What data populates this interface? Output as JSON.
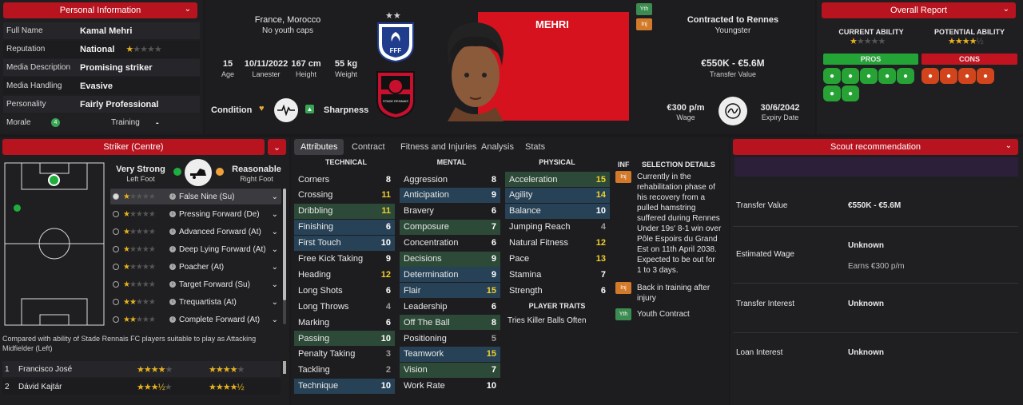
{
  "personal": {
    "title": "Personal Information",
    "rows": [
      {
        "k": "Full Name",
        "v": "Kamal Mehri"
      },
      {
        "k": "Reputation",
        "v": "National"
      },
      {
        "k": "Media Description",
        "v": "Promising striker"
      },
      {
        "k": "Media Handling",
        "v": "Evasive"
      },
      {
        "k": "Personality",
        "v": "Fairly Professional"
      }
    ],
    "morale_label": "Morale",
    "morale_value": "4",
    "training_label": "Training",
    "training_value": "-"
  },
  "header": {
    "nationality": "France, Morocco",
    "caps": "No youth caps",
    "stats": [
      {
        "v": "15",
        "k": "Age"
      },
      {
        "v": "10/11/2022",
        "k": "Lanester"
      },
      {
        "v": "167 cm",
        "k": "Height"
      },
      {
        "v": "55 kg",
        "k": "Weight"
      }
    ],
    "condition": "Condition",
    "sharpness": "Sharpness",
    "player_name": "MEHRI",
    "badge_yth": "Yth",
    "badge_inj": "Inj",
    "club_short": "STADE RENNAIS",
    "fed": "FFF"
  },
  "contract": {
    "status": "Contracted to Rennes",
    "sub": "Youngster",
    "value": "€550K - €5.6M",
    "value_label": "Transfer Value",
    "wage": "€300 p/m",
    "wage_label": "Wage",
    "expiry": "30/6/2042",
    "expiry_label": "Expiry Date"
  },
  "report": {
    "title": "Overall Report",
    "ca_label": "CURRENT ABILITY",
    "pa_label": "POTENTIAL ABILITY",
    "pros": "PROS",
    "cons": "CONS"
  },
  "position": {
    "title": "Striker (Centre)",
    "strong": "Very Strong",
    "foot_l": "Left Foot",
    "reasonable": "Reasonable",
    "foot_r": "Right Foot",
    "roles": [
      {
        "name": "False Nine (Su)",
        "stars": 1
      },
      {
        "name": "Pressing Forward (De)",
        "stars": 1
      },
      {
        "name": "Advanced Forward (At)",
        "stars": 1
      },
      {
        "name": "Deep Lying Forward (At)",
        "stars": 1
      },
      {
        "name": "Poacher (At)",
        "stars": 1
      },
      {
        "name": "Target Forward (Su)",
        "stars": 1
      },
      {
        "name": "Trequartista (At)",
        "stars": 2
      },
      {
        "name": "Complete Forward (At)",
        "stars": 2
      }
    ],
    "compare": "Compared with ability of Stade Rennais FC players suitable to play as Attacking Midfielder (Left)",
    "comp_players": [
      {
        "n": "1",
        "name": "Francisco José"
      },
      {
        "n": "2",
        "name": "Dávid Kajtár"
      }
    ]
  },
  "tabs": [
    "Attributes",
    "Contract",
    "Fitness and Injuries",
    "Analysis",
    "Stats"
  ],
  "attr": {
    "technical_h": "TECHNICAL",
    "mental_h": "MENTAL",
    "physical_h": "PHYSICAL",
    "technical": [
      [
        "Corners",
        "8"
      ],
      [
        "Crossing",
        "11"
      ],
      [
        "Dribbling",
        "11"
      ],
      [
        "Finishing",
        "6"
      ],
      [
        "First Touch",
        "10"
      ],
      [
        "Free Kick Taking",
        "9"
      ],
      [
        "Heading",
        "12"
      ],
      [
        "Long Shots",
        "6"
      ],
      [
        "Long Throws",
        "4"
      ],
      [
        "Marking",
        "6"
      ],
      [
        "Passing",
        "10"
      ],
      [
        "Penalty Taking",
        "3"
      ],
      [
        "Tackling",
        "2"
      ],
      [
        "Technique",
        "10"
      ]
    ],
    "mental": [
      [
        "Aggression",
        "8"
      ],
      [
        "Anticipation",
        "9"
      ],
      [
        "Bravery",
        "6"
      ],
      [
        "Composure",
        "7"
      ],
      [
        "Concentration",
        "6"
      ],
      [
        "Decisions",
        "9"
      ],
      [
        "Determination",
        "9"
      ],
      [
        "Flair",
        "15"
      ],
      [
        "Leadership",
        "6"
      ],
      [
        "Off The Ball",
        "8"
      ],
      [
        "Positioning",
        "5"
      ],
      [
        "Teamwork",
        "15"
      ],
      [
        "Vision",
        "7"
      ],
      [
        "Work Rate",
        "10"
      ]
    ],
    "physical": [
      [
        "Acceleration",
        "15"
      ],
      [
        "Agility",
        "14"
      ],
      [
        "Balance",
        "10"
      ],
      [
        "Jumping Reach",
        "4"
      ],
      [
        "Natural Fitness",
        "12"
      ],
      [
        "Pace",
        "13"
      ],
      [
        "Stamina",
        "7"
      ],
      [
        "Strength",
        "6"
      ]
    ],
    "traits_h": "PLAYER TRAITS",
    "trait": "Tries Killer Balls Often"
  },
  "selection": {
    "inf": "INF",
    "title": "SELECTION DETAILS",
    "items": [
      {
        "b": "Inj",
        "t": "Currently in the rehabilitation phase of his recovery from a pulled hamstring suffered during Rennes Under 19s' 8-1 win over Pôle Espoirs du Grand Est on 11th April 2038. Expected to be out for 1 to 3 days."
      },
      {
        "b": "Inj",
        "t": "Back in training after injury"
      },
      {
        "b": "Yth",
        "t": "Youth Contract"
      }
    ]
  },
  "scout": {
    "title": "Scout recommendation",
    "rows": [
      {
        "k": "Transfer Value",
        "v": "€550K - €5.6M"
      },
      {
        "k": "Estimated Wage",
        "v": "Unknown",
        "v2": "Earns €300 p/m"
      },
      {
        "k": "Transfer Interest",
        "v": "Unknown"
      },
      {
        "k": "Loan Interest",
        "v": "Unknown"
      }
    ]
  }
}
